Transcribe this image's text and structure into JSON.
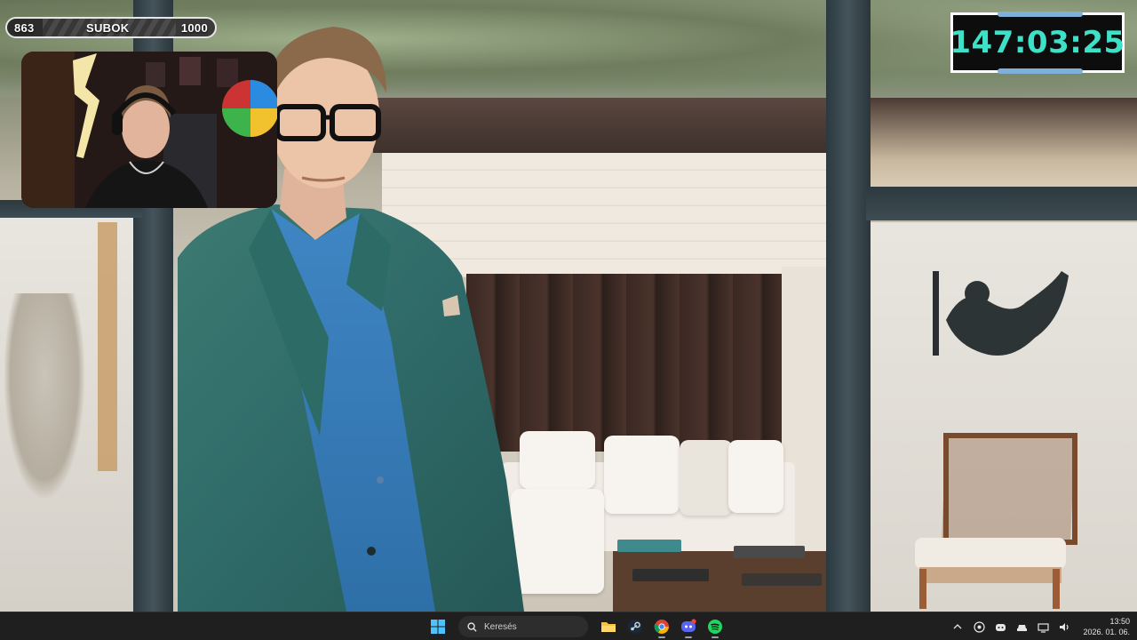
{
  "overlay": {
    "sub_goal": {
      "current": "863",
      "label": "SUBOK",
      "target": "1000",
      "progress": 0.863
    },
    "timer": {
      "value": "147:03:25",
      "color": "#3fe0c8"
    }
  },
  "taskbar": {
    "search_placeholder": "Keresés",
    "apps": [
      {
        "name": "start-icon"
      },
      {
        "name": "search-icon"
      },
      {
        "name": "file-explorer-icon"
      },
      {
        "name": "steam-icon"
      },
      {
        "name": "chrome-icon"
      },
      {
        "name": "discord-icon"
      },
      {
        "name": "spotify-icon"
      }
    ],
    "tray": {
      "time": "13:50",
      "date": "2026. 01. 06."
    }
  }
}
